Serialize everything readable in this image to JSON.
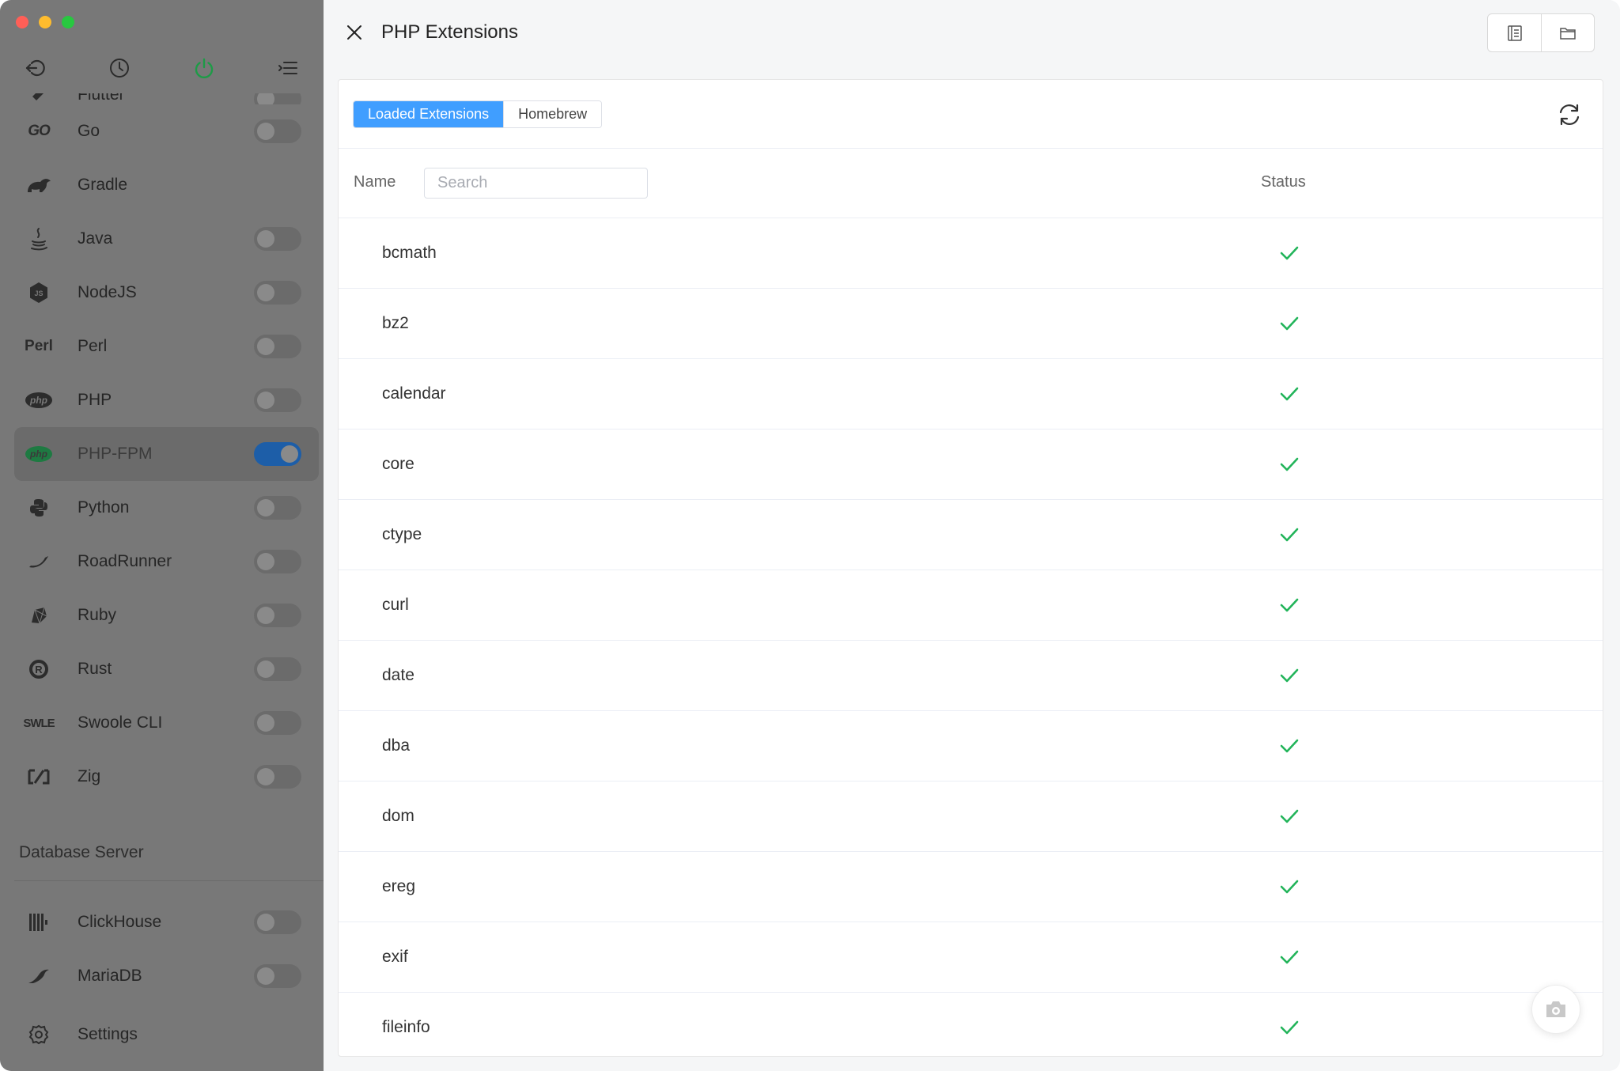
{
  "window": {
    "traffic_lights": [
      "close",
      "minimize",
      "zoom"
    ]
  },
  "sidebar": {
    "toolbar": [
      {
        "name": "back-icon"
      },
      {
        "name": "history-icon"
      },
      {
        "name": "power-icon",
        "color": "#1e9b47"
      },
      {
        "name": "menu-icon"
      }
    ],
    "languages": [
      {
        "label": "Flutter",
        "icon": "flutter-icon",
        "toggle": false,
        "partial": true
      },
      {
        "label": "Go",
        "icon": "go-icon",
        "icon_text": "GO",
        "toggle": false
      },
      {
        "label": "Gradle",
        "icon": "gradle-icon",
        "toggle": null
      },
      {
        "label": "Java",
        "icon": "java-icon",
        "toggle": false
      },
      {
        "label": "NodeJS",
        "icon": "nodejs-icon",
        "toggle": false
      },
      {
        "label": "Perl",
        "icon": "perl-icon",
        "icon_text": "Perl",
        "toggle": false
      },
      {
        "label": "PHP",
        "icon": "php-icon",
        "icon_text": "php",
        "toggle": false
      },
      {
        "label": "PHP-FPM",
        "icon": "php-icon",
        "icon_text": "php",
        "toggle": true,
        "active": true
      },
      {
        "label": "Python",
        "icon": "python-icon",
        "toggle": false
      },
      {
        "label": "RoadRunner",
        "icon": "roadrunner-icon",
        "toggle": false
      },
      {
        "label": "Ruby",
        "icon": "ruby-icon",
        "toggle": false
      },
      {
        "label": "Rust",
        "icon": "rust-icon",
        "toggle": false
      },
      {
        "label": "Swoole CLI",
        "icon": "swoole-icon",
        "icon_text": "SWLE",
        "toggle": false
      },
      {
        "label": "Zig",
        "icon": "zig-icon",
        "toggle": false
      }
    ],
    "database_section_title": "Database Server",
    "databases": [
      {
        "label": "ClickHouse",
        "icon": "clickhouse-icon",
        "toggle": false
      },
      {
        "label": "MariaDB",
        "icon": "mariadb-icon",
        "toggle": false
      }
    ],
    "settings_label": "Settings"
  },
  "main": {
    "title": "PHP Extensions",
    "tabs": [
      {
        "label": "Loaded Extensions",
        "active": true
      },
      {
        "label": "Homebrew",
        "active": false
      }
    ],
    "table": {
      "name_header": "Name",
      "search_placeholder": "Search",
      "status_header": "Status",
      "rows": [
        {
          "name": "bcmath",
          "status": "loaded"
        },
        {
          "name": "bz2",
          "status": "loaded"
        },
        {
          "name": "calendar",
          "status": "loaded"
        },
        {
          "name": "core",
          "status": "loaded"
        },
        {
          "name": "ctype",
          "status": "loaded"
        },
        {
          "name": "curl",
          "status": "loaded"
        },
        {
          "name": "date",
          "status": "loaded"
        },
        {
          "name": "dba",
          "status": "loaded"
        },
        {
          "name": "dom",
          "status": "loaded"
        },
        {
          "name": "ereg",
          "status": "loaded"
        },
        {
          "name": "exif",
          "status": "loaded"
        },
        {
          "name": "fileinfo",
          "status": "loaded"
        }
      ]
    },
    "colors": {
      "accent": "#409eff",
      "check": "#22b45a",
      "sidebar_bg": "#787878",
      "toggle_on": "#1d5ea8"
    }
  }
}
